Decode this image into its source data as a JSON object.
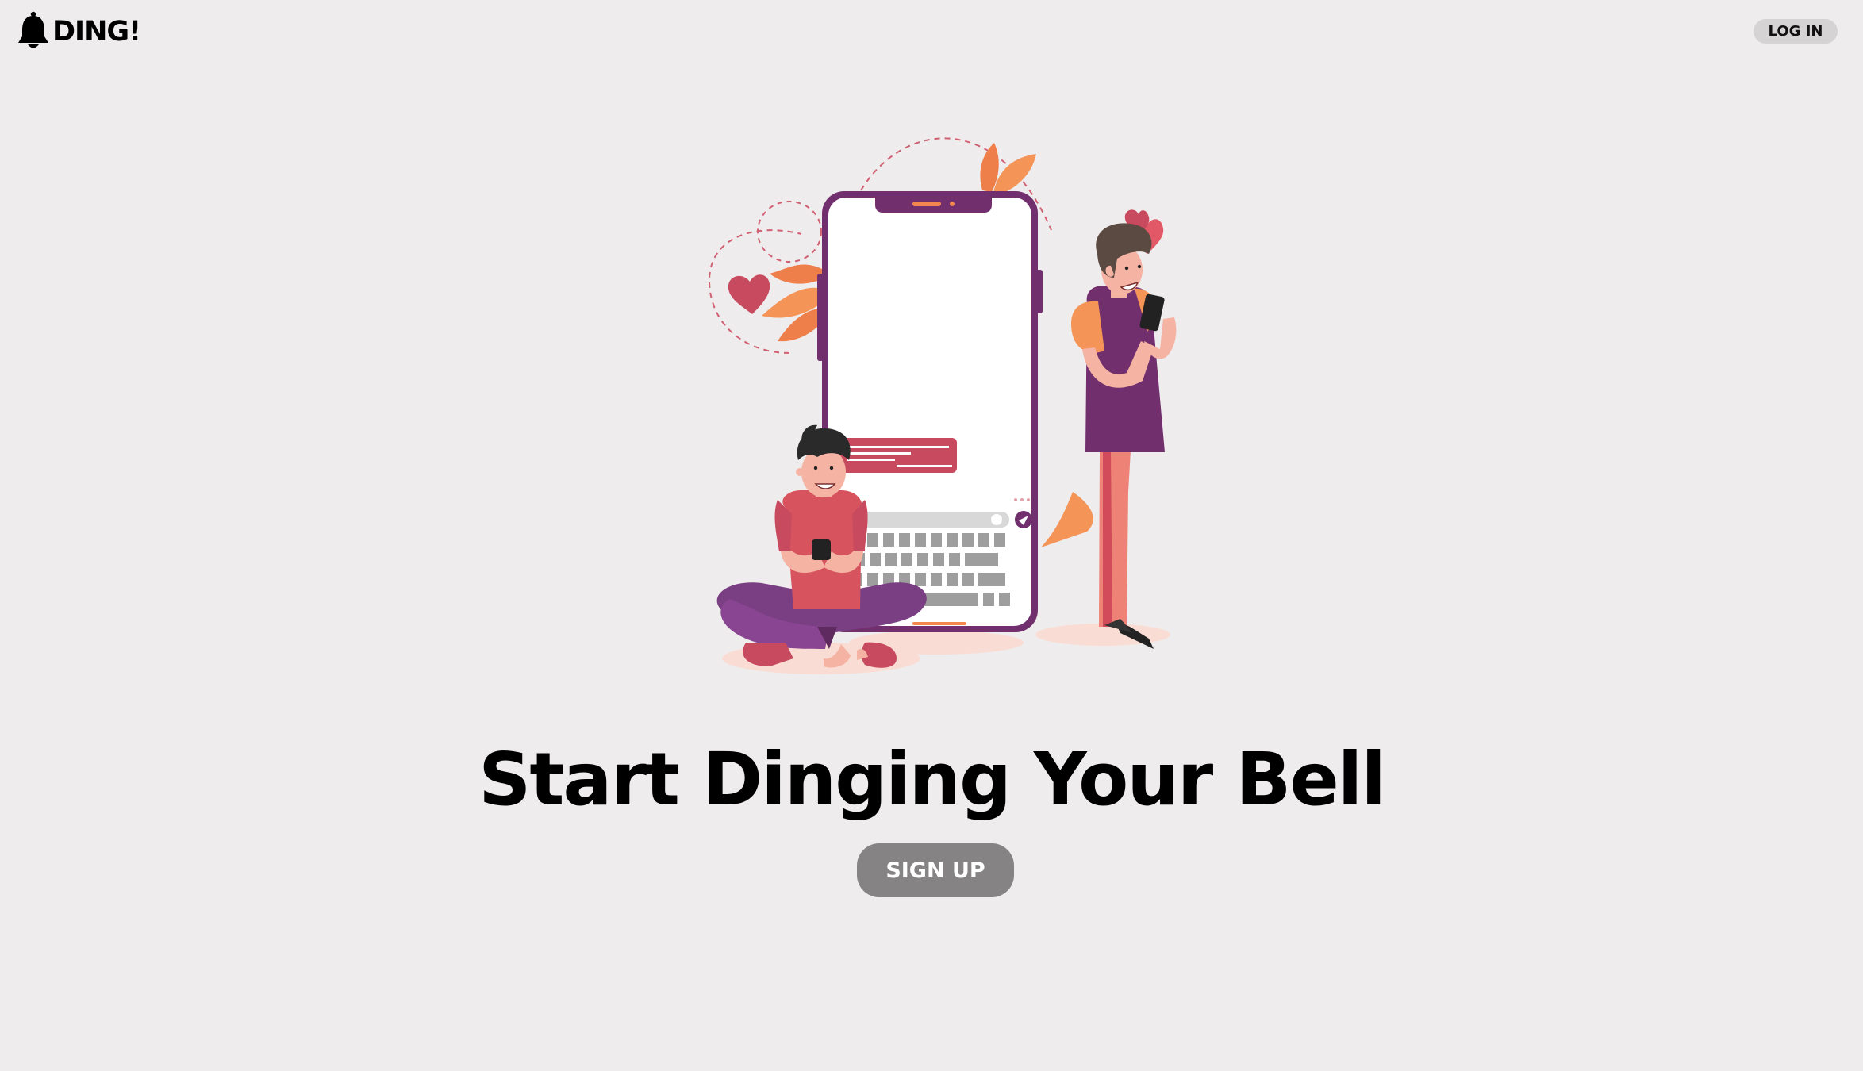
{
  "header": {
    "brand_name": "DING!",
    "brand_icon": "bell-icon",
    "login_label": "LOG IN"
  },
  "hero": {
    "illustration": "couple-texting-on-phone-illustration",
    "title": "Start Dinging Your Bell",
    "signup_label": "SIGN UP"
  },
  "colors": {
    "background": "#efeced",
    "login_button_bg": "#d6d3d4",
    "signup_button_bg": "#858384",
    "purple": "#722f6e",
    "coral": "#e95f65",
    "raspberry": "#c84a5f",
    "orange": "#f1884f",
    "skin": "#f4b3a3"
  }
}
